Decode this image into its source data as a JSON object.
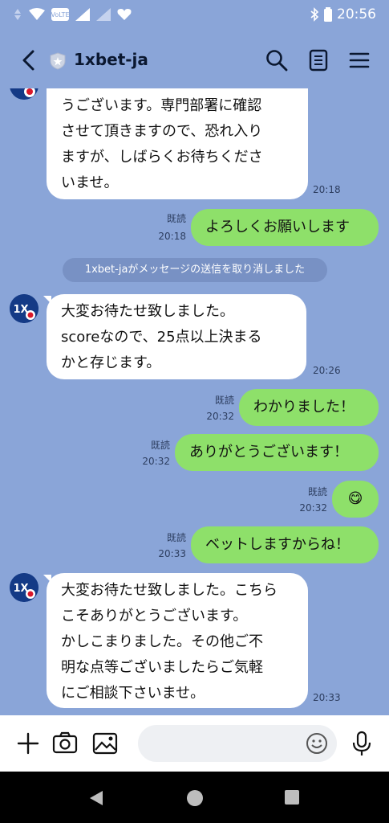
{
  "status": {
    "time": "20:56"
  },
  "header": {
    "title": "1xbet-ja"
  },
  "messages": {
    "m1": {
      "lines": [
        "うございます。専門部署に確認",
        "させて頂きますので、恐れ入り",
        "ますが、しばらくお待ちくださ",
        "いませ。"
      ],
      "time": "20:18"
    },
    "m2": {
      "text": "よろしくお願いします",
      "read": "既読",
      "time": "20:18"
    },
    "system": {
      "text": "1xbet-jaがメッセージの送信を取り消しました"
    },
    "m3": {
      "lines": [
        "大変お待たせ致しました。",
        "scoreなので、25点以上決まる",
        "かと存じます。"
      ],
      "time": "20:26"
    },
    "m4": {
      "text": "わかりました！",
      "read": "既読",
      "time": "20:32"
    },
    "m5": {
      "text": "ありがとうございます！",
      "read": "既読",
      "time": "20:32"
    },
    "m6": {
      "text": "😋",
      "read": "既読",
      "time": "20:32"
    },
    "m7": {
      "text": "ベットしますからね！",
      "read": "既読",
      "time": "20:33"
    },
    "m8": {
      "lines": [
        "大変お待たせ致しました。こちら",
        "こそありがとうございます。",
        "かしこまりました。その他ご不",
        "明な点等ございましたらご気軽",
        "にご相談下さいませ。"
      ],
      "time": "20:33"
    }
  },
  "colors": {
    "background": "#8aa5d8",
    "outgoing": "#8ee06a",
    "incoming": "#ffffff"
  },
  "icons": [
    "back-icon",
    "shield-icon",
    "search-icon",
    "notes-icon",
    "menu-icon",
    "plus-icon",
    "camera-icon",
    "image-icon",
    "emoji-icon",
    "mic-icon"
  ]
}
